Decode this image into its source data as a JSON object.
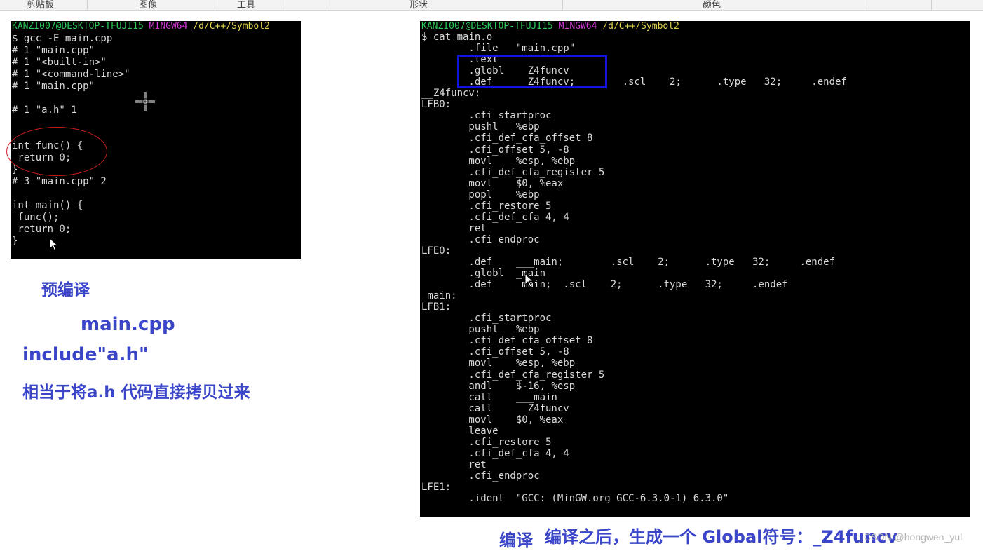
{
  "ribbon": {
    "groups": [
      "剪贴板",
      "图像",
      "工具",
      "形状",
      "颜色"
    ]
  },
  "left_terminal": {
    "title_user": "KANZI007@DESKTOP-TFUJI15",
    "title_env": "MINGW64",
    "title_path": "/d/C++/Symbol2",
    "lines": [
      "$ gcc -E main.cpp",
      "# 1 \"main.cpp\"",
      "# 1 \"<built-in>\"",
      "# 1 \"<command-line>\"",
      "# 1 \"main.cpp\"",
      "",
      "# 1 \"a.h\" 1",
      "",
      "",
      "int func() {",
      " return 0;",
      "}",
      "# 3 \"main.cpp\" 2",
      "",
      "int main() {",
      " func();",
      " return 0;",
      "}"
    ]
  },
  "right_terminal": {
    "title_user": "KANZI007@DESKTOP-TFUJI15",
    "title_env": "MINGW64",
    "title_path": "/d/C++/Symbol2",
    "lines": [
      "$ cat main.o",
      "        .file   \"main.cpp\"",
      "        .text",
      "        .globl    Z4funcv",
      "        .def    __Z4funcv;        .scl    2;      .type   32;     .endef",
      "__Z4funcv:",
      "LFB0:",
      "        .cfi_startproc",
      "        pushl   %ebp",
      "        .cfi_def_cfa_offset 8",
      "        .cfi_offset 5, -8",
      "        movl    %esp, %ebp",
      "        .cfi_def_cfa_register 5",
      "        movl    $0, %eax",
      "        popl    %ebp",
      "        .cfi_restore 5",
      "        .cfi_def_cfa 4, 4",
      "        ret",
      "        .cfi_endproc",
      "LFE0:",
      "        .def    ___main;        .scl    2;      .type   32;     .endef",
      "        .globl  _main",
      "        .def    _main;  .scl    2;      .type   32;     .endef",
      "_main:",
      "LFB1:",
      "        .cfi_startproc",
      "        pushl   %ebp",
      "        .cfi_def_cfa_offset 8",
      "        .cfi_offset 5, -8",
      "        movl    %esp, %ebp",
      "        .cfi_def_cfa_register 5",
      "        andl    $-16, %esp",
      "        call    ___main",
      "        call    __Z4funcv",
      "        movl    $0, %eax",
      "        leave",
      "        .cfi_restore 5",
      "        .cfi_def_cfa 4, 4",
      "        ret",
      "        .cfi_endproc",
      "LFE1:",
      "        .ident  \"GCC: (MinGW.org GCC-6.3.0-1) 6.3.0\""
    ]
  },
  "annotations": {
    "precompile": "预编译",
    "main_cpp": "main.cpp",
    "include": "include\"a.h\"",
    "copy_note": "相当于将a.h 代码直接拷贝过来",
    "compile": "编译",
    "global_note": "编译之后，生成一个 Global符号：_Z4funcv"
  },
  "watermark": "CSDN @hongwen_yul",
  "colors": {
    "annotation": "#3a45c8",
    "highlight_box": "#1313e0",
    "circle": "#c81e1e",
    "terminal_bg": "#000000",
    "terminal_text": "#d9d9d9"
  }
}
